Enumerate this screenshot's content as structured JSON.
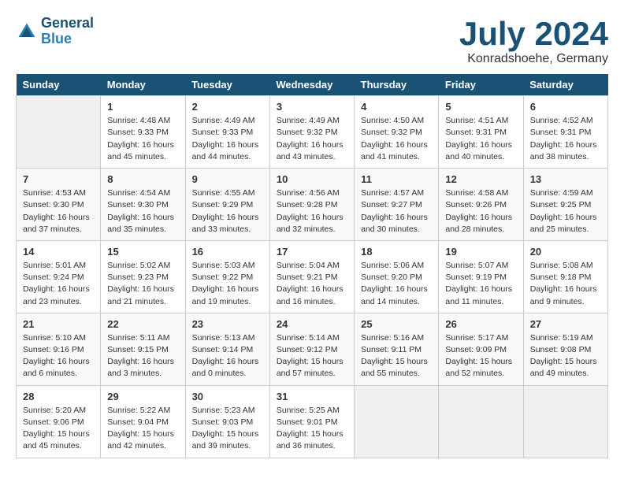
{
  "header": {
    "logo_line1": "General",
    "logo_line2": "Blue",
    "month": "July 2024",
    "location": "Konradshoehe, Germany"
  },
  "days_of_week": [
    "Sunday",
    "Monday",
    "Tuesday",
    "Wednesday",
    "Thursday",
    "Friday",
    "Saturday"
  ],
  "weeks": [
    [
      {
        "day": "",
        "empty": true
      },
      {
        "day": "1",
        "sunrise": "4:48 AM",
        "sunset": "9:33 PM",
        "daylight": "16 hours and 45 minutes."
      },
      {
        "day": "2",
        "sunrise": "4:49 AM",
        "sunset": "9:33 PM",
        "daylight": "16 hours and 44 minutes."
      },
      {
        "day": "3",
        "sunrise": "4:49 AM",
        "sunset": "9:32 PM",
        "daylight": "16 hours and 43 minutes."
      },
      {
        "day": "4",
        "sunrise": "4:50 AM",
        "sunset": "9:32 PM",
        "daylight": "16 hours and 41 minutes."
      },
      {
        "day": "5",
        "sunrise": "4:51 AM",
        "sunset": "9:31 PM",
        "daylight": "16 hours and 40 minutes."
      },
      {
        "day": "6",
        "sunrise": "4:52 AM",
        "sunset": "9:31 PM",
        "daylight": "16 hours and 38 minutes."
      }
    ],
    [
      {
        "day": "7",
        "sunrise": "4:53 AM",
        "sunset": "9:30 PM",
        "daylight": "16 hours and 37 minutes."
      },
      {
        "day": "8",
        "sunrise": "4:54 AM",
        "sunset": "9:30 PM",
        "daylight": "16 hours and 35 minutes."
      },
      {
        "day": "9",
        "sunrise": "4:55 AM",
        "sunset": "9:29 PM",
        "daylight": "16 hours and 33 minutes."
      },
      {
        "day": "10",
        "sunrise": "4:56 AM",
        "sunset": "9:28 PM",
        "daylight": "16 hours and 32 minutes."
      },
      {
        "day": "11",
        "sunrise": "4:57 AM",
        "sunset": "9:27 PM",
        "daylight": "16 hours and 30 minutes."
      },
      {
        "day": "12",
        "sunrise": "4:58 AM",
        "sunset": "9:26 PM",
        "daylight": "16 hours and 28 minutes."
      },
      {
        "day": "13",
        "sunrise": "4:59 AM",
        "sunset": "9:25 PM",
        "daylight": "16 hours and 25 minutes."
      }
    ],
    [
      {
        "day": "14",
        "sunrise": "5:01 AM",
        "sunset": "9:24 PM",
        "daylight": "16 hours and 23 minutes."
      },
      {
        "day": "15",
        "sunrise": "5:02 AM",
        "sunset": "9:23 PM",
        "daylight": "16 hours and 21 minutes."
      },
      {
        "day": "16",
        "sunrise": "5:03 AM",
        "sunset": "9:22 PM",
        "daylight": "16 hours and 19 minutes."
      },
      {
        "day": "17",
        "sunrise": "5:04 AM",
        "sunset": "9:21 PM",
        "daylight": "16 hours and 16 minutes."
      },
      {
        "day": "18",
        "sunrise": "5:06 AM",
        "sunset": "9:20 PM",
        "daylight": "16 hours and 14 minutes."
      },
      {
        "day": "19",
        "sunrise": "5:07 AM",
        "sunset": "9:19 PM",
        "daylight": "16 hours and 11 minutes."
      },
      {
        "day": "20",
        "sunrise": "5:08 AM",
        "sunset": "9:18 PM",
        "daylight": "16 hours and 9 minutes."
      }
    ],
    [
      {
        "day": "21",
        "sunrise": "5:10 AM",
        "sunset": "9:16 PM",
        "daylight": "16 hours and 6 minutes."
      },
      {
        "day": "22",
        "sunrise": "5:11 AM",
        "sunset": "9:15 PM",
        "daylight": "16 hours and 3 minutes."
      },
      {
        "day": "23",
        "sunrise": "5:13 AM",
        "sunset": "9:14 PM",
        "daylight": "16 hours and 0 minutes."
      },
      {
        "day": "24",
        "sunrise": "5:14 AM",
        "sunset": "9:12 PM",
        "daylight": "15 hours and 57 minutes."
      },
      {
        "day": "25",
        "sunrise": "5:16 AM",
        "sunset": "9:11 PM",
        "daylight": "15 hours and 55 minutes."
      },
      {
        "day": "26",
        "sunrise": "5:17 AM",
        "sunset": "9:09 PM",
        "daylight": "15 hours and 52 minutes."
      },
      {
        "day": "27",
        "sunrise": "5:19 AM",
        "sunset": "9:08 PM",
        "daylight": "15 hours and 49 minutes."
      }
    ],
    [
      {
        "day": "28",
        "sunrise": "5:20 AM",
        "sunset": "9:06 PM",
        "daylight": "15 hours and 45 minutes."
      },
      {
        "day": "29",
        "sunrise": "5:22 AM",
        "sunset": "9:04 PM",
        "daylight": "15 hours and 42 minutes."
      },
      {
        "day": "30",
        "sunrise": "5:23 AM",
        "sunset": "9:03 PM",
        "daylight": "15 hours and 39 minutes."
      },
      {
        "day": "31",
        "sunrise": "5:25 AM",
        "sunset": "9:01 PM",
        "daylight": "15 hours and 36 minutes."
      },
      {
        "day": "",
        "empty": true
      },
      {
        "day": "",
        "empty": true
      },
      {
        "day": "",
        "empty": true
      }
    ]
  ]
}
